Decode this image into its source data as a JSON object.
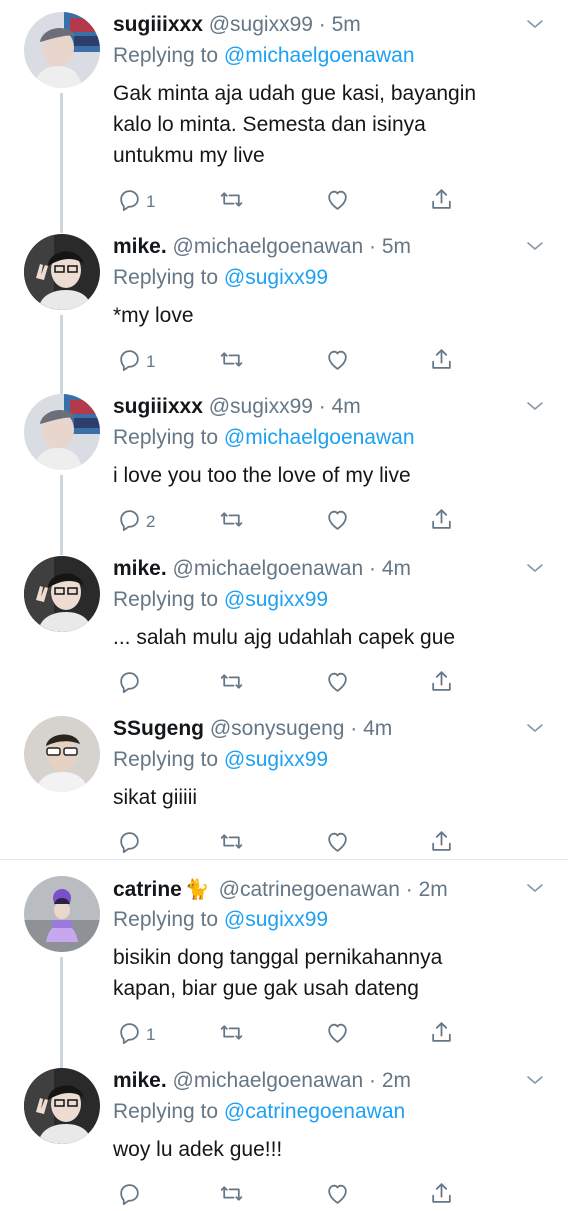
{
  "colors": {
    "accent": "#1da1f2",
    "muted": "#657786",
    "thread_line": "#cdd6dd",
    "text": "#14171a"
  },
  "tweets": [
    {
      "name": "sugiiixxx",
      "emoji": "",
      "handle": "@sugixx99",
      "time": "5m",
      "reply_label": "Replying to",
      "reply_to": "@michaelgoenawan",
      "lines": [
        "Gak minta aja udah gue kasi, bayangin",
        "kalo lo minta. Semesta dan isinya",
        "untukmu my live"
      ],
      "reply_count": "1"
    },
    {
      "name": "mike.",
      "emoji": "",
      "handle": "@michaelgoenawan",
      "time": "5m",
      "reply_label": "Replying to",
      "reply_to": "@sugixx99",
      "lines": [
        "*my love"
      ],
      "reply_count": "1"
    },
    {
      "name": "sugiiixxx",
      "emoji": "",
      "handle": "@sugixx99",
      "time": "4m",
      "reply_label": "Replying to",
      "reply_to": "@michaelgoenawan",
      "lines": [
        "i love you too the love of my live"
      ],
      "reply_count": "2"
    },
    {
      "name": "mike.",
      "emoji": "",
      "handle": "@michaelgoenawan",
      "time": "4m",
      "reply_label": "Replying to",
      "reply_to": "@sugixx99",
      "lines": [
        "... salah mulu ajg udahlah capek gue"
      ],
      "reply_count": ""
    },
    {
      "name": "SSugeng",
      "emoji": "",
      "handle": "@sonysugeng",
      "time": "4m",
      "reply_label": "Replying to",
      "reply_to": "@sugixx99",
      "lines": [
        "sikat giiiii"
      ],
      "reply_count": ""
    },
    {
      "name": "catrine",
      "emoji": "🐈",
      "handle": "@catrinegoenawan",
      "time": "2m",
      "reply_label": "Replying to",
      "reply_to": "@sugixx99",
      "lines": [
        "bisikin dong tanggal pernikahannya",
        "kapan, biar gue gak usah dateng"
      ],
      "reply_count": "1"
    },
    {
      "name": "mike.",
      "emoji": "",
      "handle": "@michaelgoenawan",
      "time": "2m",
      "reply_label": "Replying to",
      "reply_to": "@catrinegoenawan",
      "lines": [
        "woy lu adek gue!!!"
      ],
      "reply_count": ""
    }
  ]
}
